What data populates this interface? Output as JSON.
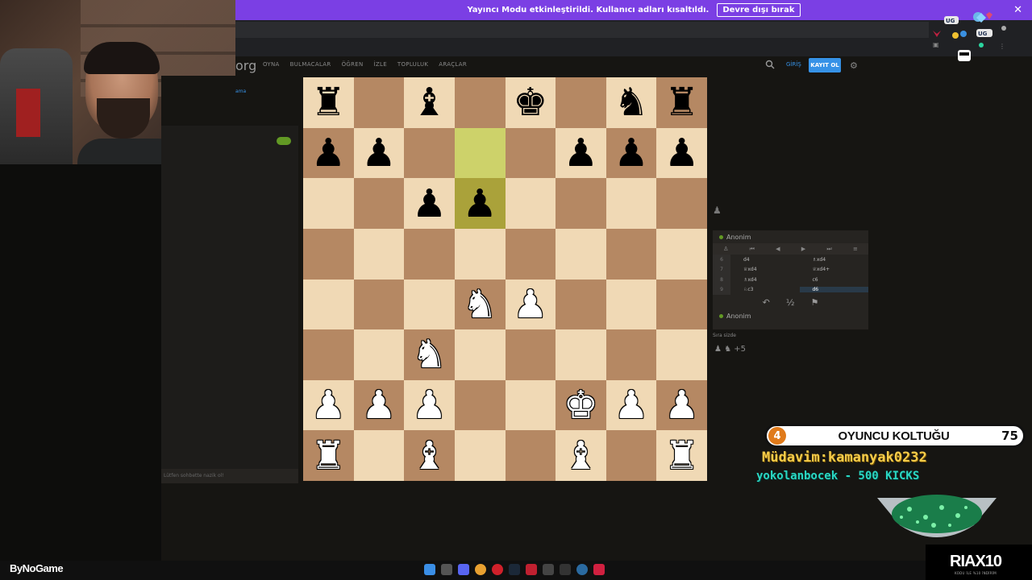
{
  "banner": {
    "message": "Yayıncı Modu etkinleştirildi. Kullanıcı adları kısaltıldı.",
    "button_label": "Devre dışı bırak",
    "close_glyph": "✕"
  },
  "site": {
    "logo_text": "org",
    "nav": [
      "OYNA",
      "BULMACALAR",
      "ÖĞREN",
      "İZLE",
      "TOPLULUK",
      "ARAÇLAR"
    ],
    "login_label": "GİRİŞ",
    "signup_label": "KAYIT OL"
  },
  "sidebar": {
    "link": "ama",
    "chat_placeholder": "Lütfen sohbette nazik ol!"
  },
  "board": {
    "highlights": [
      "d7",
      "d6"
    ],
    "ranks": [
      [
        "r",
        "",
        "b",
        "",
        "k",
        "",
        "n",
        "r"
      ],
      [
        "p",
        "p",
        "",
        "",
        "",
        "p",
        "p",
        "p"
      ],
      [
        "",
        "",
        "p",
        "p",
        "",
        "",
        "",
        ""
      ],
      [
        "",
        "",
        "",
        "",
        "",
        "",
        "",
        ""
      ],
      [
        "",
        "",
        "",
        "N",
        "P",
        "",
        "",
        ""
      ],
      [
        "",
        "",
        "N",
        "",
        "",
        "",
        "",
        ""
      ],
      [
        "P",
        "P",
        "P",
        "",
        "",
        "K",
        "P",
        "P"
      ],
      [
        "R",
        "",
        "B",
        "",
        "",
        "B",
        "",
        "R"
      ]
    ]
  },
  "game": {
    "top_player": "Anonim",
    "bottom_player": "Anonim",
    "moves": [
      {
        "num": "6",
        "white": "d4",
        "black": "♗xd4"
      },
      {
        "num": "7",
        "white": "♕xd4",
        "black": "♕xd4+"
      },
      {
        "num": "8",
        "white": "♗xd4",
        "black": "c6"
      },
      {
        "num": "9",
        "white": "♘c3",
        "black": "d6"
      }
    ],
    "your_turn": "Sıra sizde",
    "captured": "♟ ♞ +5",
    "draw_label": "½"
  },
  "overlay": {
    "seat_number": "4",
    "seat_title": "OYUNCU KOLTUĞU",
    "seat_count": "75",
    "regular_line": "Müdavim:kamanyak0232",
    "kicks_line": "yokolanbocek - 500 KICKS"
  },
  "footer": {
    "brand": "ByNoGame",
    "promo_code": "RIAX10",
    "promo_sub": "KODU İLE %10 İNDİRİM"
  },
  "colors": {
    "accent": "#3692e7",
    "banner": "#7b3fe4",
    "board_light": "#f0d9b5",
    "board_dark": "#b58863",
    "highlight": "#cdd26a"
  }
}
